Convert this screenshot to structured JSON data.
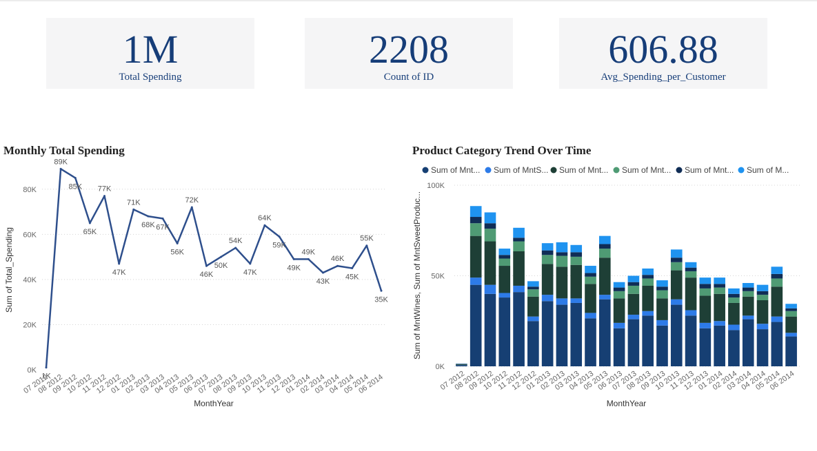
{
  "kpis": [
    {
      "value": "1M",
      "label": "Total Spending"
    },
    {
      "value": "2208",
      "label": "Count of ID"
    },
    {
      "value": "606.88",
      "label": "Avg_Spending_per_Customer"
    }
  ],
  "line_title": "Monthly Total Spending",
  "bar_title": "Product Category Trend Over Time",
  "colors": {
    "kpi_text": "#163d78",
    "line": "#2e4f8c",
    "wines": "#163f73",
    "fruits": "#2d7be8",
    "meat": "#1e3f36",
    "fish": "#4f9b74",
    "sweets": "#102d56",
    "gold": "#1f93f0"
  },
  "chart_data": [
    {
      "type": "line",
      "title": "Monthly Total Spending",
      "xlabel": "MonthYear",
      "ylabel": "Sum of Total_Spending",
      "ylim": [
        0,
        90000
      ],
      "yticks": [
        0,
        20000,
        40000,
        60000,
        80000
      ],
      "ytick_labels": [
        "0K",
        "20K",
        "40K",
        "60K",
        "80K"
      ],
      "grid": true,
      "x": [
        "07 2012",
        "08 2012",
        "09 2012",
        "10 2012",
        "11 2012",
        "12 2012",
        "01 2013",
        "02 2013",
        "03 2013",
        "04 2013",
        "05 2013",
        "06 2013",
        "07 2013",
        "08 2013",
        "09 2013",
        "10 2013",
        "11 2013",
        "12 2013",
        "01 2014",
        "02 2014",
        "03 2014",
        "04 2014",
        "05 2014",
        "06 2014"
      ],
      "series": [
        {
          "values": [
            1000,
            89000,
            85000,
            65000,
            77000,
            47000,
            71000,
            68000,
            67000,
            56000,
            72000,
            46000,
            50000,
            54000,
            47000,
            64000,
            59000,
            49000,
            49000,
            43000,
            46000,
            45000,
            55000,
            35000
          ]
        }
      ],
      "data_labels": [
        "1K",
        "89K",
        "85K",
        "65K",
        "77K",
        "47K",
        "71K",
        "68K",
        "67K",
        "56K",
        "72K",
        "46K",
        "50K",
        "54K",
        "47K",
        "64K",
        "59K",
        "49K",
        "49K",
        "43K",
        "46K",
        "45K",
        "55K",
        "35K"
      ]
    },
    {
      "type": "bar",
      "stacked": true,
      "title": "Product Category Trend Over Time",
      "xlabel": "MonthYear",
      "ylabel": "Sum of MntWines, Sum of MntSweetProduc...",
      "ylim": [
        0,
        100000
      ],
      "yticks": [
        0,
        50000,
        100000
      ],
      "ytick_labels": [
        "0K",
        "50K",
        "100K"
      ],
      "grid": true,
      "legend_position": "top-left",
      "categories": [
        "07 2012",
        "08 2012",
        "09 2012",
        "10 2012",
        "11 2012",
        "12 2012",
        "01 2013",
        "02 2013",
        "03 2013",
        "04 2013",
        "05 2013",
        "06 2013",
        "07 2013",
        "08 2013",
        "09 2013",
        "10 2013",
        "11 2013",
        "12 2013",
        "01 2014",
        "02 2014",
        "03 2014",
        "04 2014",
        "05 2014",
        "06 2014"
      ],
      "series": [
        {
          "name": "Sum of Mnt...",
          "values": [
            600,
            45000,
            40000,
            38000,
            41000,
            25000,
            36000,
            34000,
            35000,
            26500,
            37000,
            21000,
            26000,
            28000,
            22500,
            34000,
            28000,
            21000,
            22500,
            20000,
            26000,
            20500,
            24500,
            16500
          ],
          "color": "#163f73"
        },
        {
          "name": "Sum of MntS...",
          "values": [
            100,
            4000,
            5000,
            2500,
            3500,
            2500,
            3500,
            3500,
            2500,
            3000,
            2500,
            3000,
            2500,
            2500,
            3000,
            3000,
            3000,
            3000,
            2500,
            3000,
            2000,
            3000,
            3000,
            2000
          ],
          "color": "#2d7be8"
        },
        {
          "name": "Sum of Mnt...",
          "values": [
            400,
            23000,
            24000,
            15000,
            19000,
            11000,
            17000,
            17500,
            18500,
            16000,
            20500,
            13500,
            11500,
            14000,
            12000,
            16000,
            18000,
            15000,
            15000,
            12000,
            10500,
            13000,
            16500,
            9000
          ],
          "color": "#1e3f36"
        },
        {
          "name": "Sum of Mnt...",
          "values": [
            100,
            7000,
            7000,
            4000,
            5500,
            4000,
            5000,
            6000,
            4500,
            4000,
            5000,
            4000,
            4500,
            4000,
            4500,
            4500,
            3500,
            4000,
            3500,
            3000,
            3000,
            3000,
            4500,
            3000
          ],
          "color": "#4f9b74"
        },
        {
          "name": "Sum of Mnt...",
          "values": [
            200,
            3500,
            3000,
            2000,
            2000,
            1500,
            2500,
            2000,
            2500,
            2000,
            2500,
            2000,
            2000,
            2000,
            2000,
            2500,
            2000,
            2500,
            2000,
            2000,
            2000,
            2000,
            2500,
            1500
          ],
          "color": "#102d56"
        },
        {
          "name": "Sum of M...",
          "values": [
            100,
            6000,
            6000,
            3500,
            5500,
            3000,
            4000,
            5500,
            4000,
            4000,
            4500,
            3000,
            3500,
            3500,
            3500,
            4500,
            3000,
            3500,
            3500,
            3000,
            2500,
            3500,
            4000,
            2500
          ],
          "color": "#1f93f0"
        }
      ]
    }
  ]
}
